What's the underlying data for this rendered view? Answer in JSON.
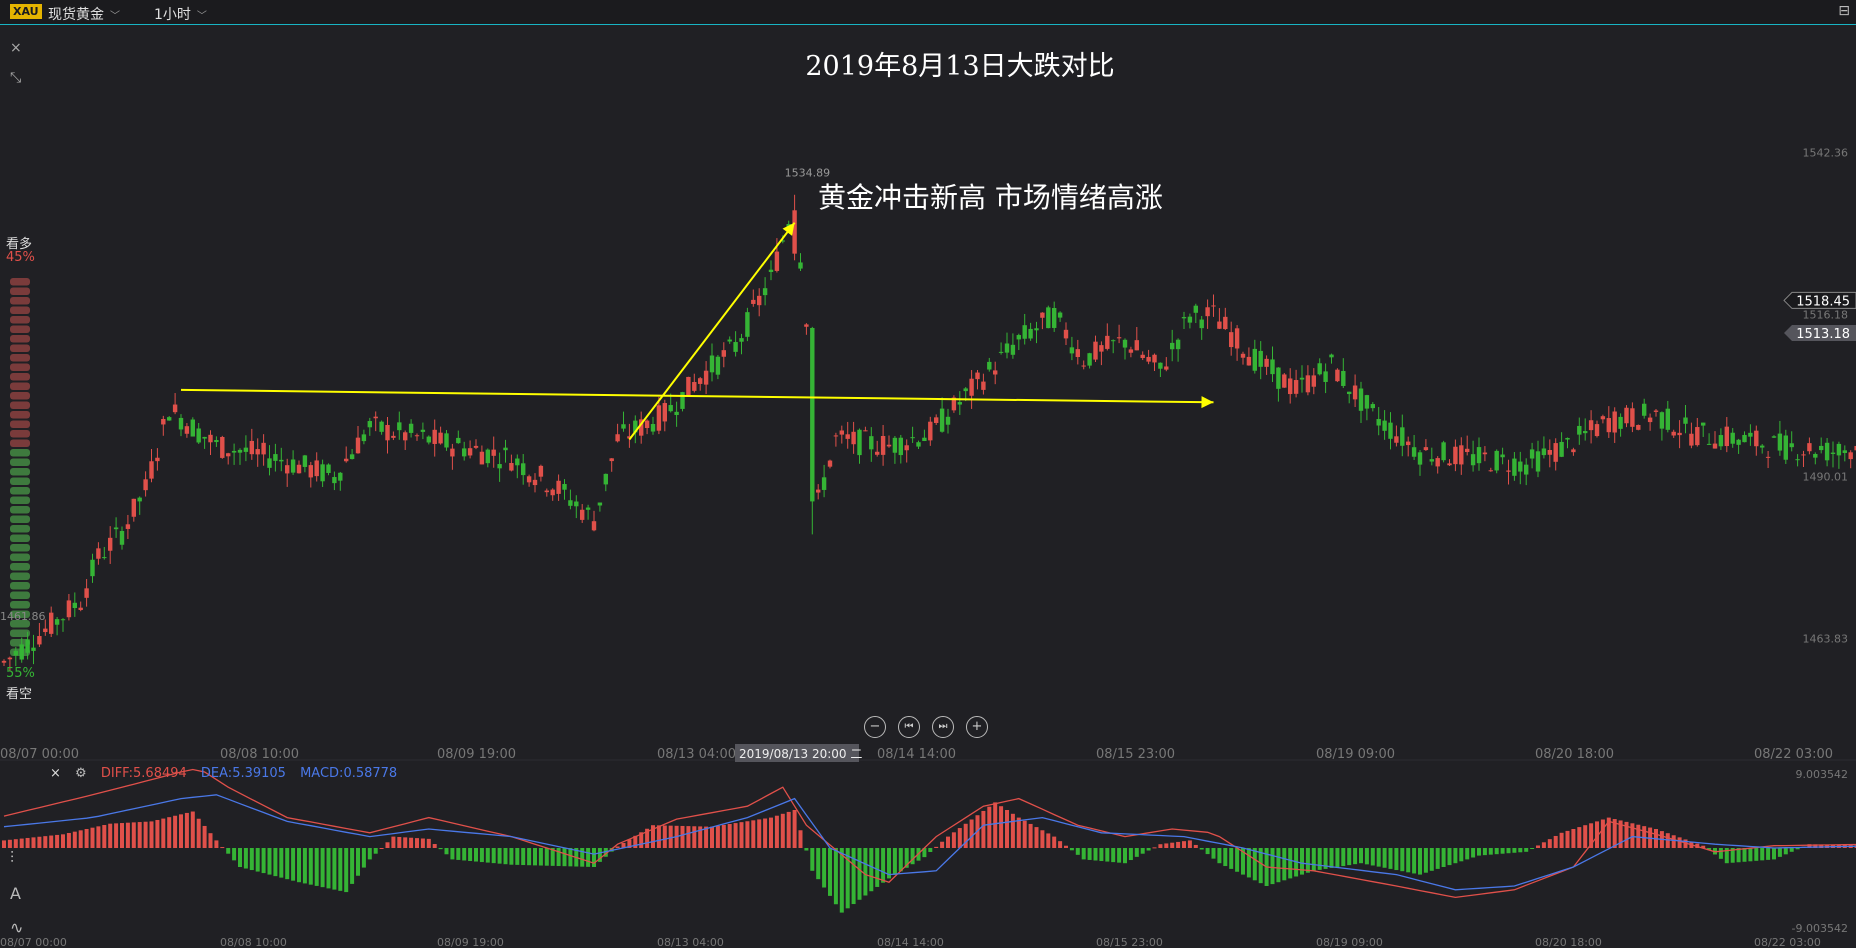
{
  "header": {
    "symbol_badge": "XAU",
    "instrument": "现货黄金",
    "period": "1小时",
    "caret": "﹀"
  },
  "left_icons": {
    "close": "×",
    "expand": "⤡"
  },
  "sentiment": {
    "bull_label": "看多",
    "bull_pct": "45%",
    "bull_value": 45,
    "bear_label": "看空",
    "bear_pct": "55%",
    "bear_value": 55,
    "side_price": "1461.86"
  },
  "controls": {
    "zoom_out": "−",
    "to_start": "⏮",
    "to_end": "⏭",
    "zoom_in": "+"
  },
  "annotation_text": "黄金冲击新高 市场情绪高涨",
  "macd_legend": {
    "close": "×",
    "diff": "DIFF:5.68494",
    "dea": "DEA:5.39105",
    "macd": "MACD:0.58778"
  },
  "tools": {
    "indicator": "⫶",
    "draw": "A",
    "wave": "∿"
  },
  "chart_data": {
    "type": "candlestick",
    "title": "2019年8月13日大跌对比",
    "price_axis_labels": [
      "1542.36",
      "1518.45",
      "1516.18",
      "1513.18",
      "1490.01",
      "1463.83"
    ],
    "price_ticks": [
      1542.36,
      1490.01,
      1463.83
    ],
    "ylim": [
      1452,
      1550
    ],
    "price_tags": {
      "current": 1518.45,
      "secondary": 1516.18,
      "bid": 1513.18
    },
    "peak_label": "1534.89",
    "peak_price": 1534.89,
    "x_labels": [
      "08/07 00:00",
      "08/08 10:00",
      "08/09 19:00",
      "08/13 04:00",
      "08/14 14:00",
      "08/15 23:00",
      "08/19 09:00",
      "08/20 18:00",
      "08/22 03:00"
    ],
    "crosshair_label": "2019/08/13 20:00 二",
    "colors": {
      "up": "#e0504a",
      "down": "#35b435",
      "annotation": "#ffff00",
      "diff": "#e0504a",
      "dea": "#4a78e8"
    },
    "keypoints": [
      [
        0,
        1460
      ],
      [
        8,
        1466
      ],
      [
        13,
        1470
      ],
      [
        16,
        1477
      ],
      [
        20,
        1481
      ],
      [
        24,
        1488
      ],
      [
        28,
        1501
      ],
      [
        36,
        1495
      ],
      [
        46,
        1493
      ],
      [
        56,
        1490
      ],
      [
        62,
        1498
      ],
      [
        72,
        1496
      ],
      [
        86,
        1493
      ],
      [
        94,
        1488
      ],
      [
        100,
        1483
      ],
      [
        104,
        1496
      ],
      [
        112,
        1500
      ],
      [
        118,
        1506
      ],
      [
        124,
        1511
      ],
      [
        130,
        1522
      ],
      [
        134,
        1534.5
      ],
      [
        136,
        1516
      ],
      [
        138,
        1486
      ],
      [
        141,
        1496
      ],
      [
        150,
        1495
      ],
      [
        157,
        1497
      ],
      [
        164,
        1504
      ],
      [
        172,
        1512
      ],
      [
        178,
        1516
      ],
      [
        183,
        1509
      ],
      [
        190,
        1512
      ],
      [
        196,
        1507
      ],
      [
        201,
        1516
      ],
      [
        205,
        1516
      ],
      [
        212,
        1509
      ],
      [
        219,
        1504
      ],
      [
        225,
        1508
      ],
      [
        232,
        1500
      ],
      [
        240,
        1494
      ],
      [
        249,
        1493
      ],
      [
        258,
        1492
      ],
      [
        265,
        1495
      ],
      [
        272,
        1499
      ],
      [
        280,
        1500
      ],
      [
        286,
        1497
      ],
      [
        294,
        1496
      ],
      [
        300,
        1495
      ],
      [
        311,
        1494
      ],
      [
        318,
        1496
      ]
    ],
    "arrows": [
      {
        "label": "horizontal",
        "from": [
          30,
          1504
        ],
        "to": [
          205,
          1502
        ]
      },
      {
        "label": "rally",
        "from": [
          106,
          1496
        ],
        "to": [
          134,
          1531
        ]
      }
    ],
    "macd_axis_labels": {
      "top": "9.003542",
      "bottom": "-9.003542"
    },
    "macd_range": [
      -9.0,
      9.0
    ],
    "macd_hist_keypoints": [
      [
        0,
        1.0
      ],
      [
        10,
        1.8
      ],
      [
        18,
        3.2
      ],
      [
        25,
        3.5
      ],
      [
        32,
        4.8
      ],
      [
        36,
        1.0
      ],
      [
        40,
        -2.5
      ],
      [
        50,
        -4.5
      ],
      [
        58,
        -5.8
      ],
      [
        62,
        -1.5
      ],
      [
        66,
        1.5
      ],
      [
        72,
        1.2
      ],
      [
        76,
        -1.5
      ],
      [
        86,
        -2.2
      ],
      [
        100,
        -2.5
      ],
      [
        104,
        0.2
      ],
      [
        110,
        3.0
      ],
      [
        120,
        2.8
      ],
      [
        130,
        4.0
      ],
      [
        134,
        5.0
      ],
      [
        137,
        -3.0
      ],
      [
        142,
        -8.5
      ],
      [
        150,
        -4.0
      ],
      [
        156,
        -1.2
      ],
      [
        160,
        1.5
      ],
      [
        168,
        6.0
      ],
      [
        172,
        4.0
      ],
      [
        178,
        1.5
      ],
      [
        183,
        -1.5
      ],
      [
        190,
        -2.0
      ],
      [
        196,
        0.5
      ],
      [
        201,
        1.0
      ],
      [
        206,
        -2.0
      ],
      [
        214,
        -5.0
      ],
      [
        222,
        -3.0
      ],
      [
        230,
        -2.0
      ],
      [
        240,
        -3.5
      ],
      [
        250,
        -1.0
      ],
      [
        258,
        -0.5
      ],
      [
        264,
        2.0
      ],
      [
        272,
        4.0
      ],
      [
        280,
        2.5
      ],
      [
        288,
        0.3
      ],
      [
        292,
        -2.0
      ],
      [
        300,
        -1.5
      ],
      [
        306,
        0.5
      ],
      [
        318,
        0.3
      ]
    ],
    "diff_keypoints": [
      [
        0,
        4.2
      ],
      [
        15,
        7.0
      ],
      [
        30,
        10.0
      ],
      [
        33,
        10.5
      ],
      [
        38,
        8.0
      ],
      [
        48,
        4.0
      ],
      [
        62,
        2.0
      ],
      [
        72,
        4.0
      ],
      [
        86,
        1.5
      ],
      [
        100,
        -2.0
      ],
      [
        104,
        0.5
      ],
      [
        114,
        3.8
      ],
      [
        126,
        5.5
      ],
      [
        132,
        8.0
      ],
      [
        136,
        3.0
      ],
      [
        146,
        -3.5
      ],
      [
        150,
        -4.5
      ],
      [
        158,
        1.5
      ],
      [
        166,
        5.5
      ],
      [
        172,
        6.5
      ],
      [
        182,
        3.0
      ],
      [
        190,
        1.5
      ],
      [
        198,
        2.5
      ],
      [
        205,
        2.0
      ],
      [
        214,
        -2.5
      ],
      [
        222,
        -3.0
      ],
      [
        236,
        -5.0
      ],
      [
        246,
        -6.5
      ],
      [
        256,
        -5.5
      ],
      [
        266,
        -2.5
      ],
      [
        272,
        3.5
      ],
      [
        280,
        1.8
      ],
      [
        290,
        -0.5
      ],
      [
        300,
        0.3
      ],
      [
        318,
        0.5
      ]
    ],
    "dea_keypoints": [
      [
        0,
        2.8
      ],
      [
        15,
        4.0
      ],
      [
        30,
        6.5
      ],
      [
        36,
        7.0
      ],
      [
        48,
        3.5
      ],
      [
        62,
        1.5
      ],
      [
        72,
        2.5
      ],
      [
        86,
        1.5
      ],
      [
        100,
        -0.8
      ],
      [
        114,
        1.5
      ],
      [
        126,
        4.0
      ],
      [
        134,
        6.5
      ],
      [
        140,
        0.0
      ],
      [
        150,
        -3.5
      ],
      [
        158,
        -3.0
      ],
      [
        166,
        3.0
      ],
      [
        176,
        4.0
      ],
      [
        186,
        2.0
      ],
      [
        200,
        1.5
      ],
      [
        210,
        0.0
      ],
      [
        220,
        -2.0
      ],
      [
        236,
        -3.5
      ],
      [
        246,
        -5.5
      ],
      [
        256,
        -5.0
      ],
      [
        266,
        -2.5
      ],
      [
        276,
        1.5
      ],
      [
        290,
        0.5
      ],
      [
        300,
        0.0
      ],
      [
        318,
        0.3
      ]
    ]
  }
}
